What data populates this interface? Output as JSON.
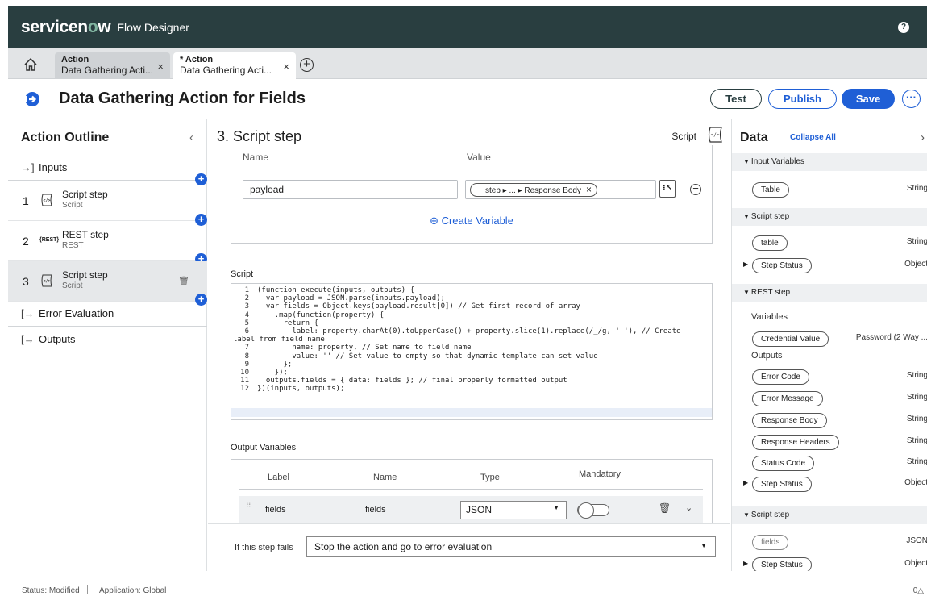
{
  "app": {
    "brand_prefix": "servicen",
    "brand_o": "o",
    "brand_suffix": "w",
    "product": "Flow Designer",
    "help_icon": "help-icon"
  },
  "tabs": [
    {
      "type": "Action",
      "title": "Data Gathering Acti...",
      "close": "×"
    },
    {
      "type": "* Action",
      "title": "Data Gathering Acti...",
      "close": "×"
    }
  ],
  "tab_add": "+",
  "page": {
    "title": "Data Gathering Action for Fields",
    "buttons": {
      "test": "Test",
      "publish": "Publish",
      "save": "Save",
      "more": "···"
    }
  },
  "outline": {
    "title": "Action Outline",
    "collapse": "‹",
    "inputs": "Inputs",
    "steps": [
      {
        "num": "1",
        "icon": "script-icon",
        "name": "Script step",
        "sub": "Script"
      },
      {
        "num": "2",
        "icon": "rest-icon",
        "icon_text": "{REST}",
        "name": "REST step",
        "sub": "REST"
      },
      {
        "num": "3",
        "icon": "script-icon",
        "name": "Script step",
        "sub": "Script"
      }
    ],
    "error_evaluation": "Error Evaluation",
    "outputs": "Outputs",
    "plus": "+"
  },
  "step": {
    "title": "3. Script step",
    "type_label": "Script",
    "input_vars": {
      "col_name": "Name",
      "col_value": "Value",
      "name_value": "payload",
      "pill_text": "step ▸ ... ▸ Response Body",
      "pill_close": "×",
      "create_variable": "⊕ Create Variable"
    },
    "script_label": "Script",
    "code_line_numbers": [
      "1",
      "2",
      "3",
      "4",
      "5",
      "6",
      "",
      "7",
      "8",
      "9",
      "10",
      "11",
      "12"
    ],
    "code": [
      "(function execute(inputs, outputs) {",
      "  var payload = JSON.parse(inputs.payload);",
      "  var fields = Object.keys(payload.result[0]) // Get first record of array",
      "    .map(function(property) {",
      "      return {",
      "        label: property.charAt(0).toUpperCase() + property.slice(1).replace(/_/g, ' '), // Create",
      "label from field name",
      "        name: property, // Set name to field name",
      "        value: '' // Set value to empty so that dynamic template can set value",
      "      };",
      "    });",
      "  outputs.fields = { data: fields }; // final properly formatted output",
      "})(inputs, outputs);"
    ],
    "output_vars": {
      "label": "Output Variables",
      "headers": {
        "label": "Label",
        "name": "Name",
        "type": "Type",
        "mandatory": "Mandatory"
      },
      "row": {
        "drag": "⠿",
        "label": "fields",
        "name": "fields",
        "type": "JSON",
        "mandatory": false
      }
    },
    "fail": {
      "label": "If this step fails",
      "value": "Stop the action and go to error evaluation"
    }
  },
  "data_panel": {
    "title": "Data",
    "collapse_all": "Collapse All",
    "sections": {
      "input_variables": "Input Variables",
      "script_step_1": "Script step",
      "rest_step": "REST step",
      "script_step_2": "Script step"
    },
    "rest_variables_label": "Variables",
    "rest_outputs_label": "Outputs",
    "items": {
      "table_in": {
        "label": "Table",
        "type": "String"
      },
      "table": {
        "label": "table",
        "type": "String"
      },
      "step_status_1": {
        "label": "Step Status",
        "type": "Object"
      },
      "credential_value": {
        "label": "Credential Value",
        "type": "Password (2 Way ..."
      },
      "error_code": {
        "label": "Error Code",
        "type": "String"
      },
      "error_message": {
        "label": "Error Message",
        "type": "String"
      },
      "response_body": {
        "label": "Response Body",
        "type": "String"
      },
      "response_headers": {
        "label": "Response Headers",
        "type": "String"
      },
      "status_code": {
        "label": "Status Code",
        "type": "String"
      },
      "step_status_2": {
        "label": "Step Status",
        "type": "Object"
      },
      "fields": {
        "label": "fields",
        "type": "JSON"
      },
      "step_status_3": {
        "label": "Step Status",
        "type": "Object"
      }
    }
  },
  "status": {
    "state": "Status: Modified",
    "application": "Application: Global",
    "count": "0△"
  }
}
